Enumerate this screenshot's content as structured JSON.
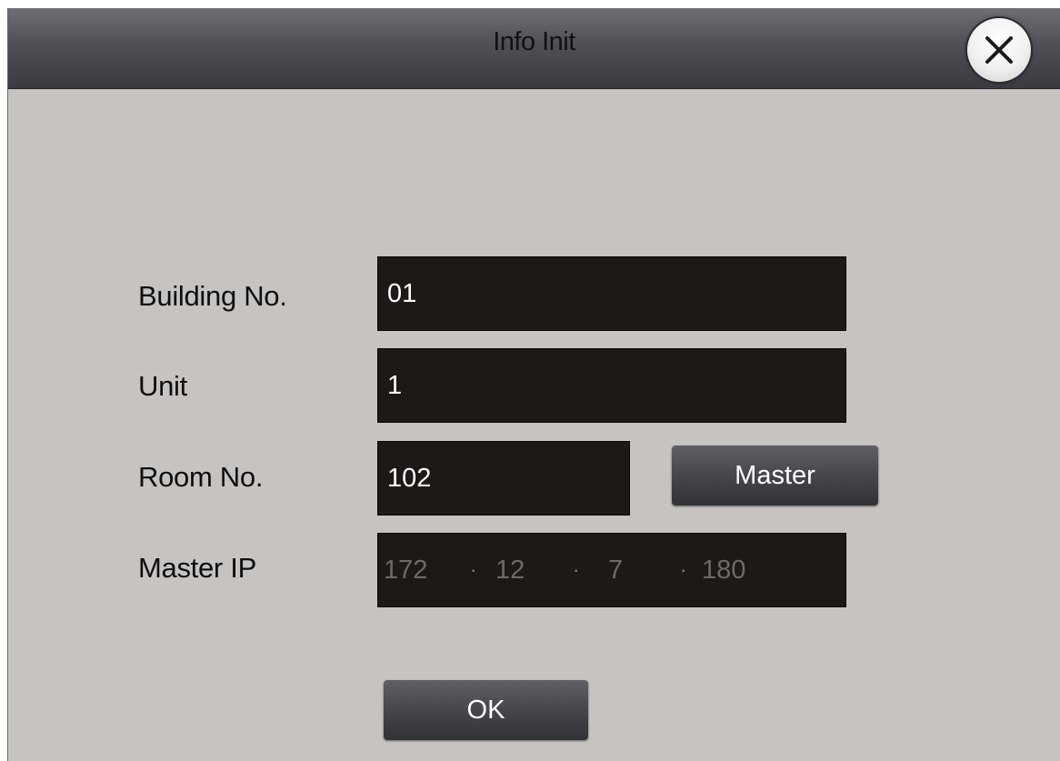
{
  "dialog": {
    "title": "Info Init",
    "close_icon": "close-x-icon"
  },
  "form": {
    "building_label": "Building No.",
    "building_value": "01",
    "unit_label": "Unit",
    "unit_value": "1",
    "room_label": "Room No.",
    "room_value": "102",
    "master_button_label": "Master",
    "master_ip_label": "Master IP",
    "master_ip": [
      "172",
      "12",
      "7",
      "180"
    ]
  },
  "actions": {
    "ok_label": "OK"
  },
  "colors": {
    "dialog_bg": "#c6c3c1",
    "field_bg": "#1e1816",
    "titlebar_dark": "#3a3b40",
    "disabled_text": "#6e6a68"
  }
}
